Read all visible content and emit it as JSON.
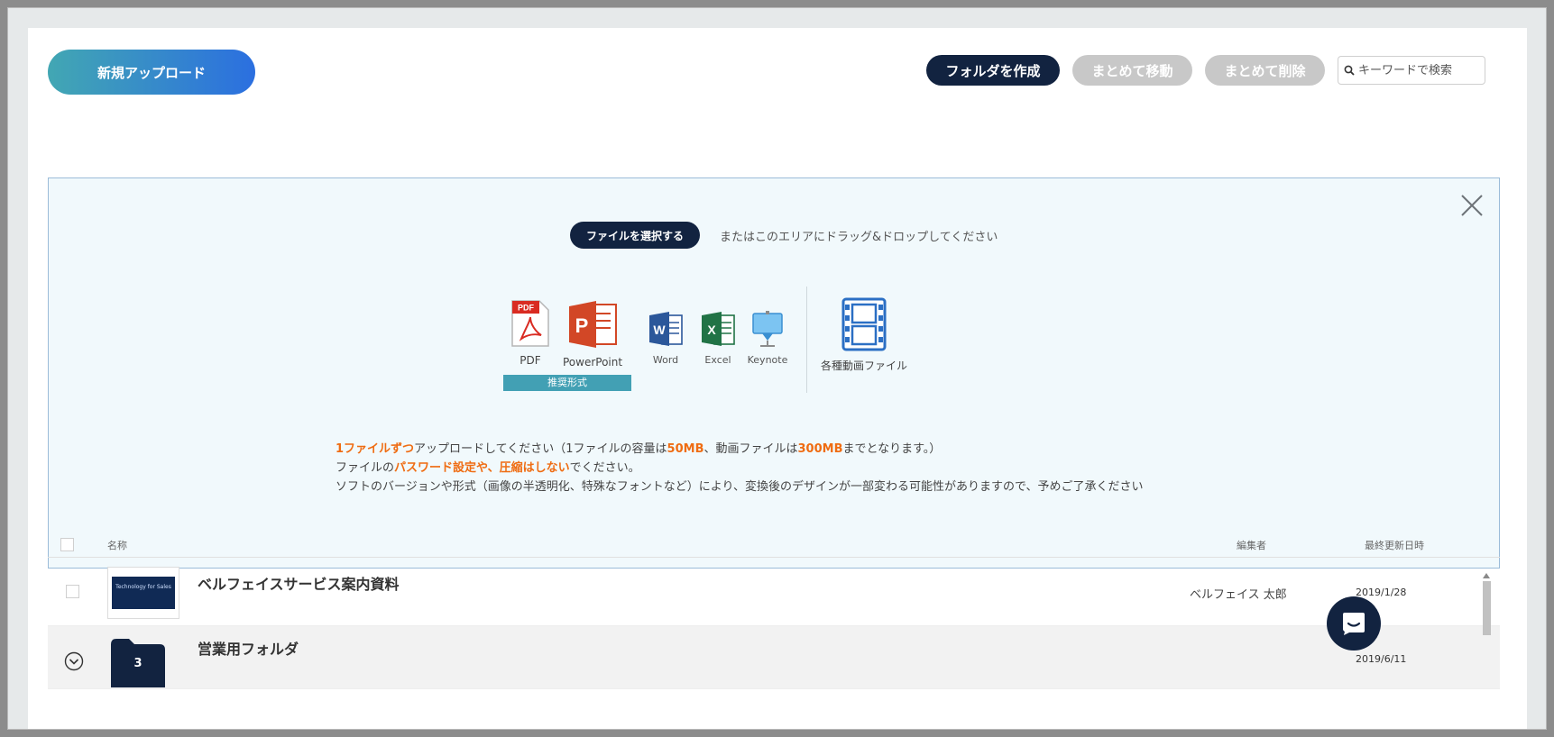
{
  "header": {
    "upload_label": "新規アップロード",
    "create_folder_label": "フォルダを作成",
    "bulk_move_label": "まとめて移動",
    "bulk_delete_label": "まとめて削除",
    "search_placeholder": "キーワードで検索"
  },
  "dropzone": {
    "select_file_label": "ファイルを選択する",
    "drop_hint": "またはこのエリアにドラッグ&ドロップしてください",
    "formats": [
      {
        "label": "PDF",
        "icon": "pdf-icon"
      },
      {
        "label": "PowerPoint",
        "icon": "powerpoint-icon"
      },
      {
        "label": "Word",
        "icon": "word-icon"
      },
      {
        "label": "Excel",
        "icon": "excel-icon"
      },
      {
        "label": "Keynote",
        "icon": "keynote-icon"
      }
    ],
    "recommended_badge": "推奨形式",
    "video_label": "各種動画ファイル",
    "notes": {
      "line1_hl1": "1ファイルずつ",
      "line1_a": "アップロードしてください（1ファイルの容量は",
      "line1_hl2": "50MB",
      "line1_b": "、動画ファイルは",
      "line1_hl3": "300MB",
      "line1_c": "までとなります。）",
      "line2_a": "ファイルの",
      "line2_hl": "パスワード設定や、圧縮はしない",
      "line2_b": "でください。",
      "line3": "ソフトのバージョンや形式（画像の半透明化、特殊なフォントなど）により、変換後のデザインが一部変わる可能性がありますので、予めご了承ください"
    }
  },
  "table": {
    "columns": {
      "name": "名称",
      "editor": "編集者",
      "updated": "最終更新日時"
    },
    "rows": [
      {
        "title": "ベルフェイスサービス案内資料",
        "thumb_text": "Technology for Sales",
        "editor": "ベルフェイス 太郎",
        "date": "2019/1/28"
      },
      {
        "title": "営業用フォルダ",
        "folder_count": "3",
        "date": "2019/6/11"
      }
    ]
  },
  "colors": {
    "navy": "#122340",
    "accent": "#ef6c12",
    "teal": "#42a0b4"
  }
}
